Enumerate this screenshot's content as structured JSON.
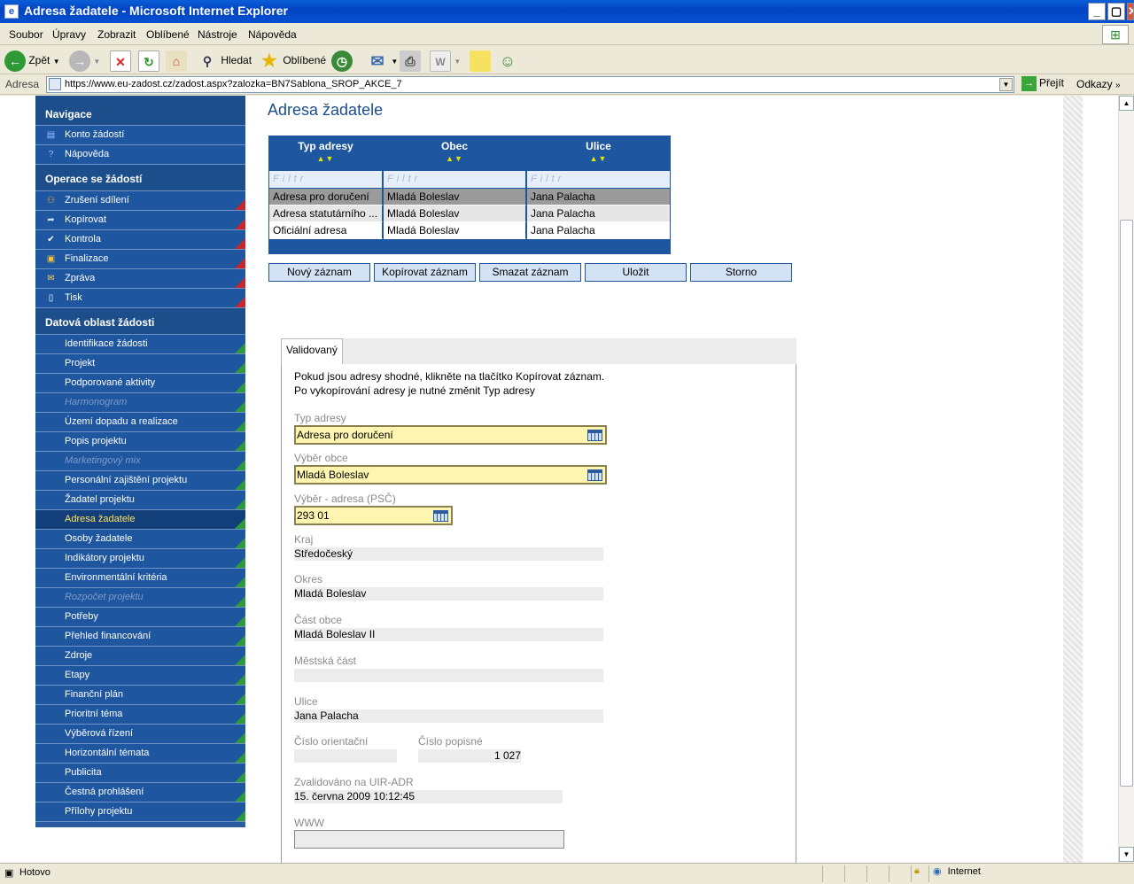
{
  "window": {
    "title": "Adresa žadatele - Microsoft Internet Explorer",
    "minimize": "_",
    "maximize": "▢",
    "close": "✕"
  },
  "menu": [
    "Soubor",
    "Úpravy",
    "Zobrazit",
    "Oblíbené",
    "Nástroje",
    "Nápověda"
  ],
  "toolbar": {
    "back": "Zpět",
    "search": "Hledat",
    "favorites": "Oblíbené"
  },
  "address": {
    "label": "Adresa",
    "url": "https://www.eu-zadost.cz/zadost.aspx?zalozka=BN7Sablona_SROP_AKCE_7",
    "go": "Přejít",
    "links": "Odkazy"
  },
  "sidebar": {
    "nav_header": "Navigace",
    "nav_items": [
      {
        "label": "Konto žádostí",
        "icon": "book-icon"
      },
      {
        "label": "Nápověda",
        "icon": "help-icon"
      }
    ],
    "ops_header": "Operace se žádostí",
    "ops_items": [
      {
        "label": "Zrušení sdílení",
        "icon": "people-icon"
      },
      {
        "label": "Kopírovat",
        "icon": "arrow-icon"
      },
      {
        "label": "Kontrola",
        "icon": "check-icon"
      },
      {
        "label": "Finalizace",
        "icon": "lock-icon"
      },
      {
        "label": "Zpráva",
        "icon": "envelope-icon"
      },
      {
        "label": "Tisk",
        "icon": "document-icon"
      }
    ],
    "data_header": "Datová oblast žádosti",
    "data_items": [
      {
        "label": "Identifikace žádosti",
        "state": "normal"
      },
      {
        "label": "Projekt",
        "state": "normal"
      },
      {
        "label": "Podporované aktivity",
        "state": "normal"
      },
      {
        "label": "Harmonogram",
        "state": "disabled"
      },
      {
        "label": "Území dopadu a realizace",
        "state": "normal"
      },
      {
        "label": "Popis projektu",
        "state": "normal"
      },
      {
        "label": "Marketingový mix",
        "state": "disabled"
      },
      {
        "label": "Personální zajištění projektu",
        "state": "normal"
      },
      {
        "label": "Žadatel projektu",
        "state": "normal"
      },
      {
        "label": "Adresa žadatele",
        "state": "selected"
      },
      {
        "label": "Osoby žadatele",
        "state": "normal"
      },
      {
        "label": "Indikátory projektu",
        "state": "normal"
      },
      {
        "label": "Environmentální kritéria",
        "state": "normal"
      },
      {
        "label": "Rozpočet projektu",
        "state": "disabled"
      },
      {
        "label": "Potřeby",
        "state": "normal"
      },
      {
        "label": "Přehled financování",
        "state": "normal"
      },
      {
        "label": "Zdroje",
        "state": "normal"
      },
      {
        "label": "Etapy",
        "state": "normal"
      },
      {
        "label": "Finanční plán",
        "state": "normal"
      },
      {
        "label": "Prioritní téma",
        "state": "normal"
      },
      {
        "label": "Výběrová řízení",
        "state": "normal"
      },
      {
        "label": "Horizontální témata",
        "state": "normal"
      },
      {
        "label": "Publicita",
        "state": "normal"
      },
      {
        "label": "Čestná prohlášení",
        "state": "normal"
      },
      {
        "label": "Přílohy projektu",
        "state": "normal"
      }
    ]
  },
  "main": {
    "title": "Adresa žadatele",
    "grid": {
      "columns": [
        "Typ adresy",
        "Obec",
        "Ulice"
      ],
      "sort_glyph": "▲▼",
      "filter_placeholder": "Filtr",
      "rows": [
        [
          "Adresa pro doručení",
          "Mladá Boleslav",
          "Jana Palacha"
        ],
        [
          "Adresa statutárního ...",
          "Mladá Boleslav",
          "Jana Palacha"
        ],
        [
          "Oficiální adresa",
          "Mladá Boleslav",
          "Jana Palacha"
        ]
      ]
    },
    "buttons": [
      "Nový záznam",
      "Kopírovat záznam",
      "Smazat záznam",
      "Uložit",
      "Storno"
    ],
    "tab": "Validovaný",
    "info_line1": "Pokud jsou adresy shodné, klikněte na tlačítko Kopírovat záznam.",
    "info_line2": "Po vykopírování adresy je nutné změnit Typ adresy",
    "fields": {
      "typ_adresy": {
        "label": "Typ adresy",
        "value": "Adresa pro doručení"
      },
      "vyber_obce": {
        "label": "Výběr obce",
        "value": "Mladá Boleslav"
      },
      "vyber_adresa": {
        "label": "Výběr - adresa (PSČ)",
        "value": "293 01"
      },
      "kraj": {
        "label": "Kraj",
        "value": "Středočeský"
      },
      "okres": {
        "label": "Okres",
        "value": "Mladá Boleslav"
      },
      "cast_obce": {
        "label": "Část obce",
        "value": "Mladá Boleslav II"
      },
      "mestska_cast": {
        "label": "Městská část",
        "value": ""
      },
      "ulice": {
        "label": "Ulice",
        "value": "Jana Palacha"
      },
      "cislo_orientacni": {
        "label": "Číslo orientační",
        "value": ""
      },
      "cislo_popisne": {
        "label": "Číslo popisné",
        "value": "1 027"
      },
      "zvalidovano": {
        "label": "Zvalidováno na UIR-ADR",
        "value": "15. června 2009 10:12:45"
      },
      "www": {
        "label": "WWW",
        "value": ""
      }
    }
  },
  "status": {
    "text": "Hotovo",
    "zone": "Internet"
  },
  "colors": {
    "nav_blue": "#1f56a0",
    "selected_text": "#ffe35a",
    "input_yellow": "#fdf5b0"
  }
}
